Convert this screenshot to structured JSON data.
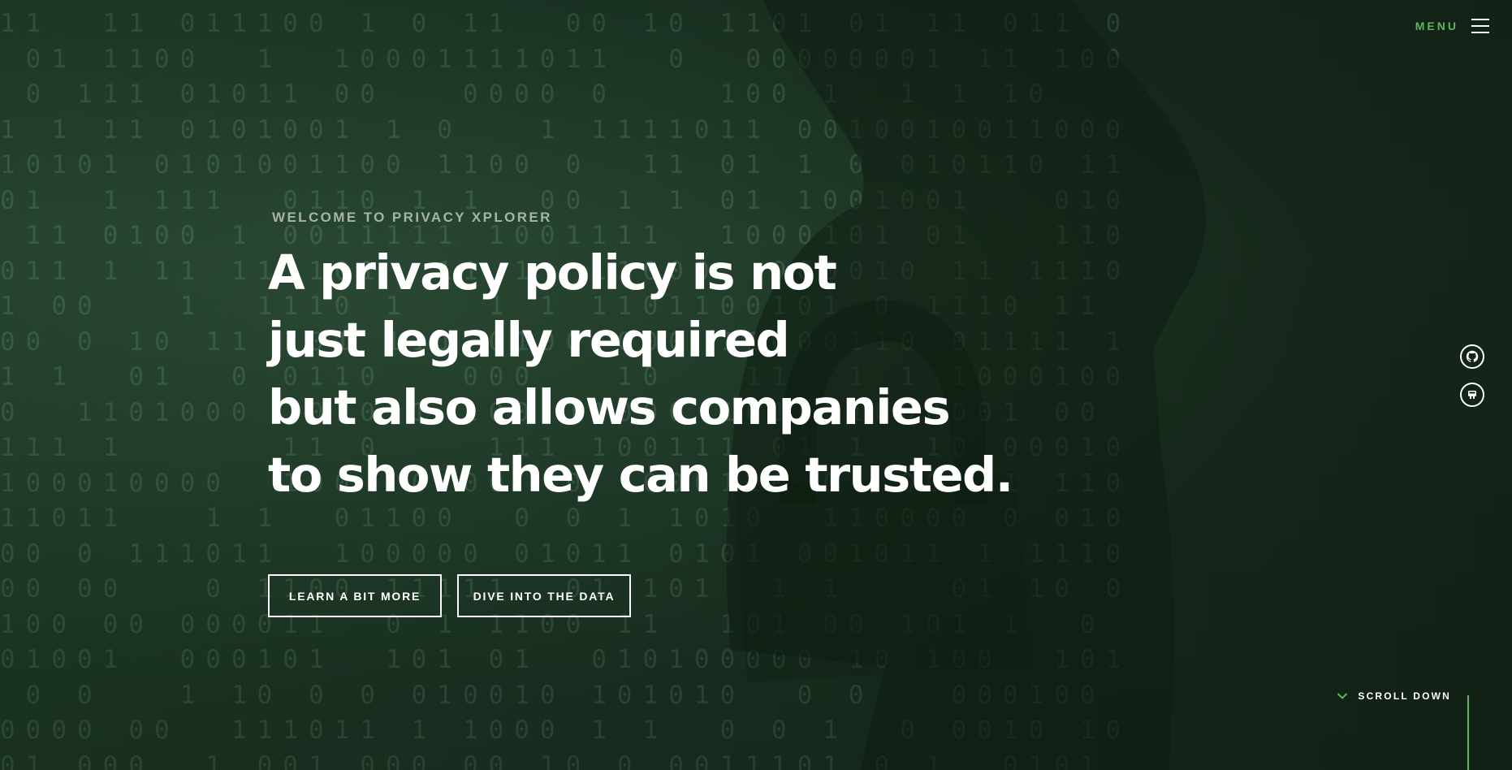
{
  "header": {
    "menu_label": "MENU"
  },
  "hero": {
    "eyebrow": "WELCOME TO PRIVACY XPLORER",
    "headline_lines": [
      "A privacy policy is not",
      "just legally required",
      "but also allows companies",
      "to show they can be trusted."
    ],
    "buttons": [
      {
        "label": "LEARN A BIT MORE"
      },
      {
        "label": "DIVE INTO THE DATA"
      }
    ]
  },
  "social": {
    "items": [
      {
        "icon": "github-icon"
      },
      {
        "icon": "data-icon"
      }
    ]
  },
  "scroll": {
    "label": "SCROLL DOWN"
  },
  "colors": {
    "accent": "#5fb55a",
    "background": "#1a3223",
    "text": "#ffffff",
    "eyebrow": "#a8b3ab"
  }
}
